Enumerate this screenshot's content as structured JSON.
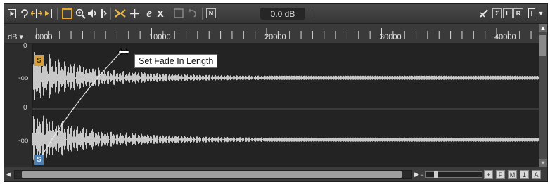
{
  "toolbar": {
    "icons": [
      "play-icon",
      "loop-icon",
      "move-icon",
      "jump-icon",
      "range-select-icon",
      "zoom-icon",
      "speaker-icon",
      "scrub-icon",
      "crossfade-icon",
      "draw-cross-icon",
      "edit-e-icon",
      "delete-x-icon",
      "snap-icon",
      "undo-icon",
      "normalize-icon"
    ],
    "normalize_label": "N",
    "gain_value": "0.0 dB",
    "right_labels": {
      "sigma": "Σ",
      "L": "L",
      "R": "R"
    },
    "colors": {
      "range_select": "#e0a92a",
      "icons": "#e8e8e8"
    }
  },
  "ruler": {
    "unit_label": "dB",
    "unit_dropdown": "▾",
    "ticks": [
      "0000",
      "10000",
      "20000",
      "30000",
      "40000"
    ]
  },
  "amplitude_labels": {
    "channel1": {
      "top": "0",
      "mid": "-oo"
    },
    "channel2": {
      "top": "0",
      "mid": "-oo"
    }
  },
  "markers": {
    "start_top": "S",
    "start_bottom": "S"
  },
  "tooltip": {
    "text": "Set Fade In Length"
  },
  "bottom": {
    "zoom_buttons": [
      "+",
      "F",
      "M",
      "1",
      "A"
    ],
    "colors": {
      "waveform": "#c8c8c8",
      "background": "#232323"
    }
  }
}
